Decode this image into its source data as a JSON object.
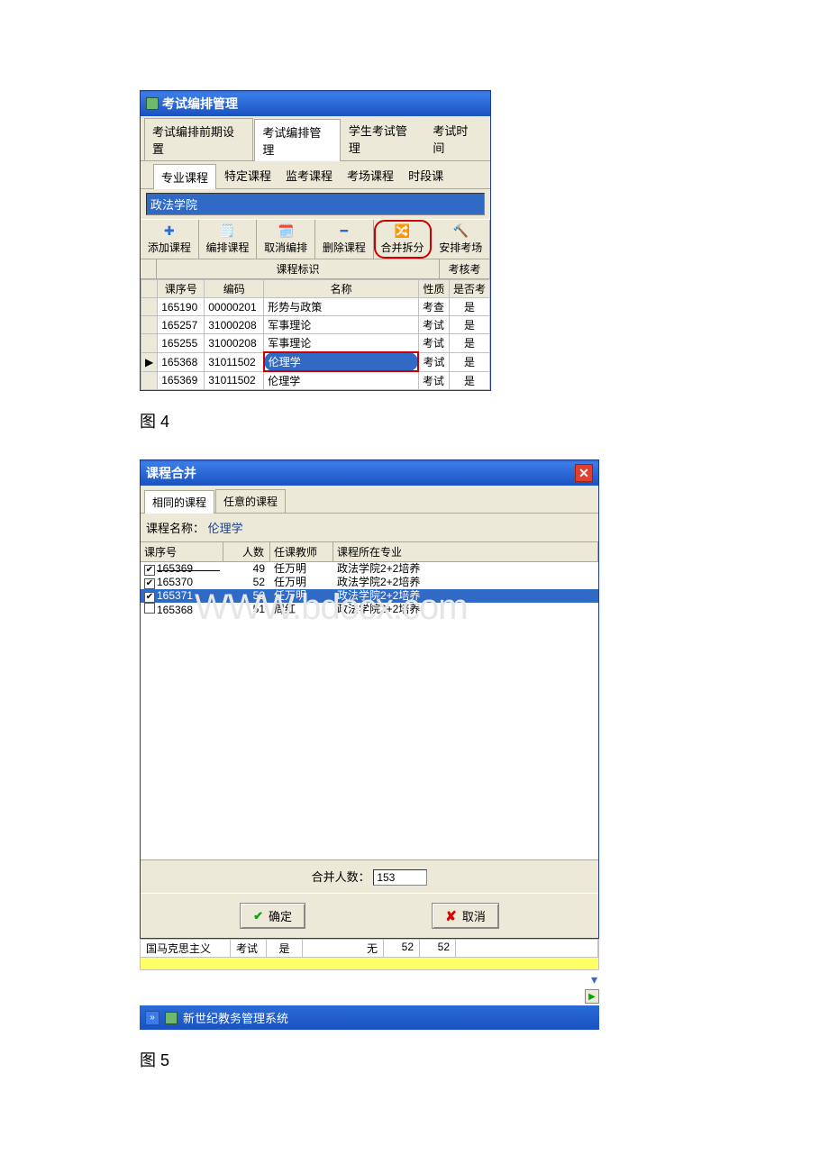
{
  "win1": {
    "title": "考试编排管理",
    "tabs": {
      "t1": "考试编排前期设置",
      "t2": "考试编排管理",
      "t3": "学生考试管理",
      "t4": "考试时间"
    },
    "subtabs": {
      "s1": "专业课程",
      "s2": "特定课程",
      "s3": "监考课程",
      "s4": "考场课程",
      "s5": "时段课"
    },
    "selected_unit": "政法学院",
    "toolbar": {
      "add": "添加课程",
      "edit": "编排课程",
      "cancel": "取消编排",
      "del": "删除课程",
      "merge": "合并拆分",
      "arrange": "安排考场"
    },
    "section_labels": {
      "course_id": "课程标识",
      "assess": "考核考"
    },
    "cols": {
      "seq": "课序号",
      "code": "编码",
      "name": "名称",
      "nature": "性质",
      "isexam": "是否考"
    },
    "rows": [
      {
        "seq": "165190",
        "code": "00000201",
        "name": "形势与政策",
        "nature": "考查",
        "isexam": "是"
      },
      {
        "seq": "165257",
        "code": "31000208",
        "name": "军事理论",
        "nature": "考试",
        "isexam": "是"
      },
      {
        "seq": "165255",
        "code": "31000208",
        "name": "军事理论",
        "nature": "考试",
        "isexam": "是"
      },
      {
        "seq": "165368",
        "code": "31011502",
        "name": "伦理学",
        "nature": "考试",
        "isexam": "是"
      },
      {
        "seq": "165369",
        "code": "31011502",
        "name": "伦理学",
        "nature": "考试",
        "isexam": "是"
      }
    ]
  },
  "fig4_label": "图 4",
  "win2": {
    "title": "课程合并",
    "tabs": {
      "same": "相同的课程",
      "any": "任意的课程"
    },
    "course_label": "课程名称：",
    "course_name": "伦理学",
    "cols": {
      "seq": "课序号",
      "num": "人数",
      "teacher": "任课教师",
      "major": "课程所在专业"
    },
    "rows": [
      {
        "checked": true,
        "seq": "165369",
        "num": "49",
        "teacher": "任万明",
        "major": "政法学院2+2培养",
        "struck": true
      },
      {
        "checked": true,
        "seq": "165370",
        "num": "52",
        "teacher": "任万明",
        "major": "政法学院2+2培养"
      },
      {
        "checked": true,
        "seq": "165371",
        "num": "52",
        "teacher": "任万明",
        "major": "政法学院2+2培养",
        "selected": true
      },
      {
        "checked": false,
        "seq": "165368",
        "num": "51",
        "teacher": "周红",
        "major": "政法学院2+2培养"
      }
    ],
    "merge_label": "合并人数：",
    "merge_value": "153",
    "ok": "确定",
    "cancel": "取消",
    "watermark": "WWW.bdocx.com"
  },
  "below_row": {
    "c1": "国马克思主义",
    "c2": "考试",
    "c3": "是",
    "c4": "无",
    "c5": "52",
    "c6": "52"
  },
  "taskbar_label": "新世纪教务管理系统",
  "fig5_label": "图 5"
}
